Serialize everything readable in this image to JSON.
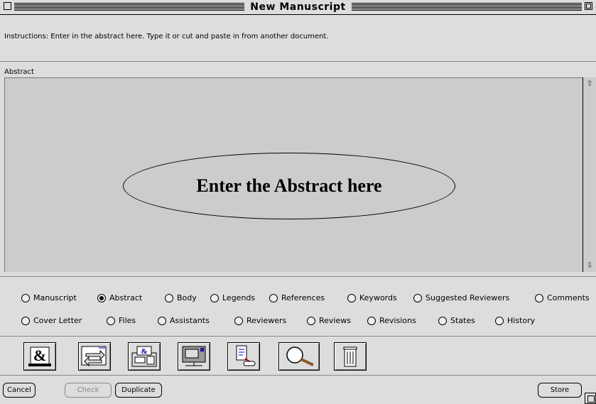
{
  "window": {
    "title": "New Manuscript"
  },
  "instructions": "Instructions: Enter in the abstract here. Type it or cut and paste in from another document.",
  "abstract": {
    "label": "Abstract",
    "value": "",
    "annotation": "Enter the Abstract here"
  },
  "tabs_row1": [
    {
      "label": "Manuscript",
      "selected": false
    },
    {
      "label": "Abstract",
      "selected": true
    },
    {
      "label": "Body",
      "selected": false
    },
    {
      "label": "Legends",
      "selected": false
    },
    {
      "label": "References",
      "selected": false
    },
    {
      "label": "Keywords",
      "selected": false
    },
    {
      "label": "Suggested Reviewers",
      "selected": false
    },
    {
      "label": "Comments",
      "selected": false
    }
  ],
  "tabs_row2": [
    {
      "label": "Cover Letter",
      "selected": false
    },
    {
      "label": "Files",
      "selected": false
    },
    {
      "label": "Assistants",
      "selected": false
    },
    {
      "label": "Reviewers",
      "selected": false
    },
    {
      "label": "Reviews",
      "selected": false
    },
    {
      "label": "Revisions",
      "selected": false
    },
    {
      "label": "States",
      "selected": false
    },
    {
      "label": "History",
      "selected": false
    }
  ],
  "toolbar_icons": [
    "mail-ampersand-icon",
    "transfer-arrows-icon",
    "fax-machine-icon",
    "computer-terminal-icon",
    "document-export-icon",
    "magnifier-icon",
    "trash-icon"
  ],
  "buttons": {
    "cancel": "Cancel",
    "check": "Check",
    "duplicate": "Duplicate",
    "store": "Store"
  }
}
